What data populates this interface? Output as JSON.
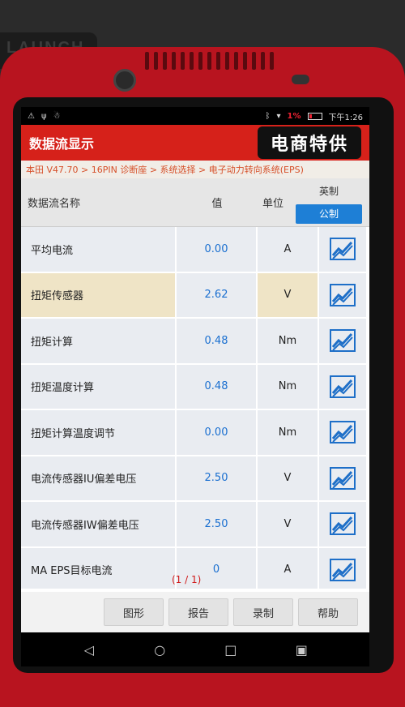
{
  "device": {
    "brand": "LAUNCH"
  },
  "status_bar": {
    "left_icons": [
      "warning-icon",
      "usb-icon",
      "android-debug-icon"
    ],
    "battery_percent": "1%",
    "time": "下午1:26"
  },
  "header": {
    "title": "数据流显示",
    "watermark": "电商特供"
  },
  "breadcrumb": "本田 V47.70 > 16PIN 诊断座 > 系统选择 > 电子动力转向系统(EPS)",
  "table": {
    "columns": {
      "name": "数据流名称",
      "value": "值",
      "unit": "单位"
    },
    "unit_toggle": {
      "imperial": "英制",
      "metric": "公制",
      "selected": "metric"
    },
    "rows": [
      {
        "name": "平均电流",
        "value": "0.00",
        "unit": "A"
      },
      {
        "name": "扭矩传感器",
        "value": "2.62",
        "unit": "V",
        "selected": true
      },
      {
        "name": "扭矩计算",
        "value": "0.48",
        "unit": "Nm"
      },
      {
        "name": "扭矩温度计算",
        "value": "0.48",
        "unit": "Nm"
      },
      {
        "name": "扭矩计算温度调节",
        "value": "0.00",
        "unit": "Nm"
      },
      {
        "name": "电流传感器IU偏差电压",
        "value": "2.50",
        "unit": "V"
      },
      {
        "name": "电流传感器IW偏差电压",
        "value": "2.50",
        "unit": "V"
      },
      {
        "name": "MA EPS目标电流",
        "value": "0",
        "unit": "A"
      }
    ],
    "page_indicator": "(1 / 1)"
  },
  "toolbar": {
    "graph": "图形",
    "report": "报告",
    "record": "录制",
    "help": "帮助"
  },
  "colors": {
    "header_red": "#d6211a",
    "value_blue": "#1a6fd0",
    "toggle_blue": "#1e7fd6",
    "selected_row": "#efe4c6"
  }
}
